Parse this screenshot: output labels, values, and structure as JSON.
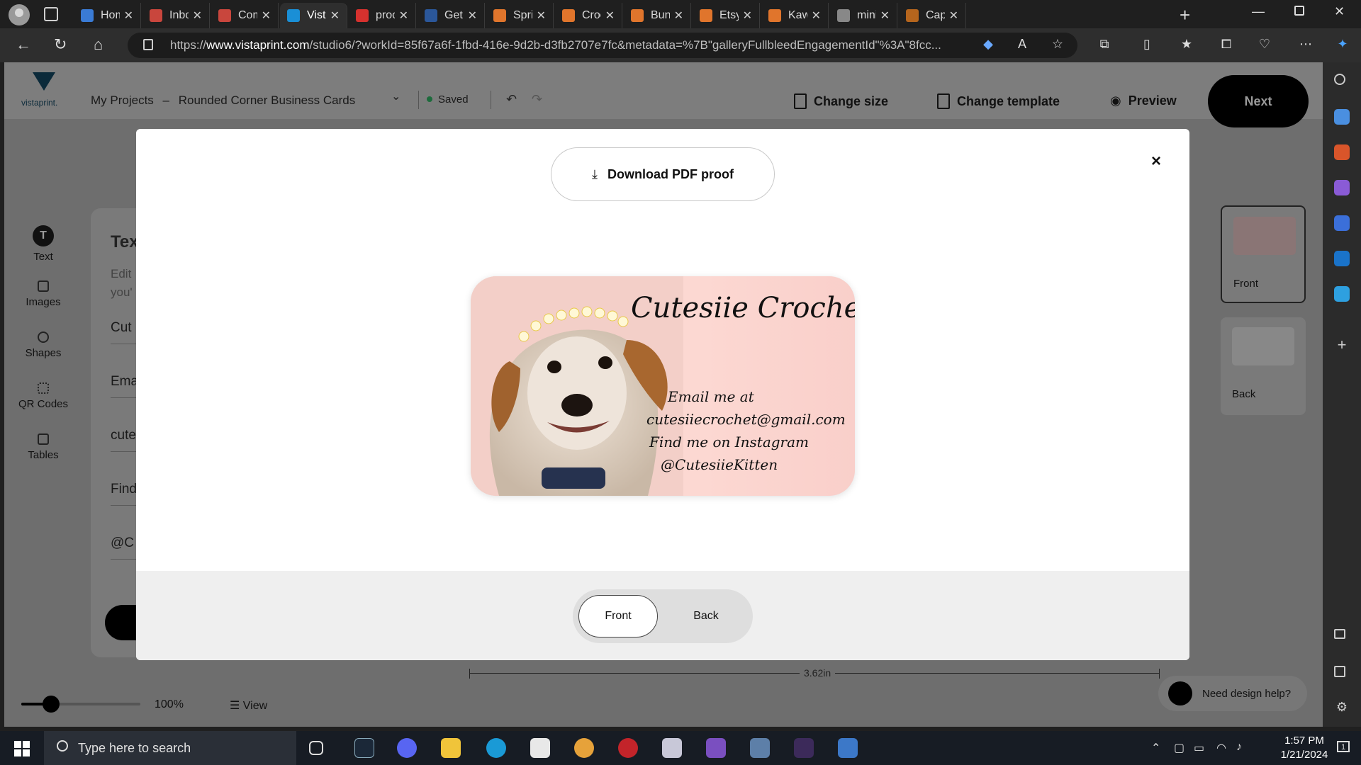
{
  "browser": {
    "tabs": [
      {
        "label": "Home",
        "favicon": "copilot-icon",
        "color": "#3a7bd5"
      },
      {
        "label": "Inbox",
        "favicon": "gmail-icon",
        "color": "#c9463d"
      },
      {
        "label": "Comp",
        "favicon": "gmail-icon",
        "color": "#c9463d"
      },
      {
        "label": "VistaP",
        "favicon": "vistaprint-icon",
        "color": "#1a8fd6",
        "active": true
      },
      {
        "label": "proof",
        "favicon": "pdf-icon",
        "color": "#d6312e"
      },
      {
        "label": "Get y",
        "favicon": "word-icon",
        "color": "#2b579a"
      },
      {
        "label": "Sprin",
        "favicon": "etsy-icon",
        "color": "#e0752c"
      },
      {
        "label": "Croch",
        "favicon": "etsy-icon",
        "color": "#e0752c"
      },
      {
        "label": "Bunn",
        "favicon": "etsy-icon",
        "color": "#e0752c"
      },
      {
        "label": "Etsy -",
        "favicon": "etsy-icon",
        "color": "#e0752c"
      },
      {
        "label": "Kawa",
        "favicon": "etsy-icon",
        "color": "#e0752c"
      },
      {
        "label": "mini c",
        "favicon": "google-icon",
        "color": "#888888"
      },
      {
        "label": "Capsu",
        "favicon": "capsule-icon",
        "color": "#b5651d"
      }
    ],
    "url_prefix": "https://",
    "url_host": "www.vistaprint.com",
    "url_rest": "/studio6/?workId=85f67a6f-1fbd-416e-9d2b-d3fb2707e7fc&metadata=%7B\"galleryFullbleedEngagementId\"%3A\"8fcc..."
  },
  "header": {
    "logo_text": "vistaprint.",
    "breadcrumb_projects": "My Projects",
    "breadcrumb_sep": "–",
    "breadcrumb_product": "Rounded Corner Business Cards",
    "saved": "Saved",
    "change_size": "Change size",
    "change_template": "Change template",
    "preview": "Preview",
    "next": "Next"
  },
  "tools": [
    {
      "label": "Text",
      "icon": "text-icon"
    },
    {
      "label": "Images",
      "icon": "image-icon"
    },
    {
      "label": "Shapes",
      "icon": "shapes-icon"
    },
    {
      "label": "QR Codes",
      "icon": "qr-icon"
    },
    {
      "label": "Tables",
      "icon": "table-icon"
    }
  ],
  "text_panel": {
    "title": "Tex",
    "desc_line1": "Edit",
    "desc_line2": "you'",
    "fields": [
      "Cut",
      "Ema",
      "cute",
      "Find",
      "@C"
    ]
  },
  "sides": {
    "front": "Front",
    "back": "Back"
  },
  "ruler_label": "3.62in",
  "zoom": {
    "value": "100%",
    "level": 0.25
  },
  "view_label": "View",
  "help_label": "Need design help?",
  "modal": {
    "download_label": "Download PDF proof",
    "close_label": "×",
    "card": {
      "title": "Cutesiie Crochet",
      "line1": "Email me at",
      "line2": "cutesiiecrochet@gmail.com",
      "line3": "Find me on Instagram",
      "line4": "@CutesiieKitten",
      "bg_color": "#f9d3cd"
    },
    "toggle_front": "Front",
    "toggle_back": "Back"
  },
  "taskbar": {
    "search_placeholder": "Type here to search",
    "time": "1:57 PM",
    "date": "1/21/2024",
    "notification_count": "1"
  }
}
